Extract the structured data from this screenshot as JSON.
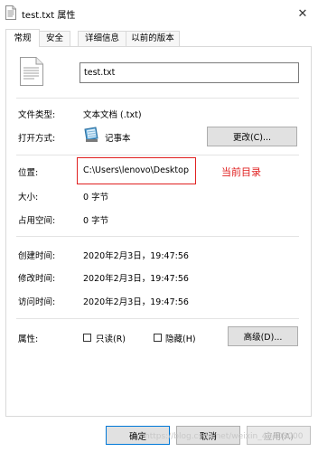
{
  "window": {
    "title": "test.txt 属性",
    "close_glyph": "✕"
  },
  "tabs": [
    {
      "label": "常规"
    },
    {
      "label": "安全"
    },
    {
      "label": "详细信息"
    },
    {
      "label": "以前的版本"
    }
  ],
  "general": {
    "file_name": "test.txt",
    "file_type_label": "文件类型:",
    "file_type_value": "文本文档 (.txt)",
    "open_with_label": "打开方式:",
    "open_with_value": "记事本",
    "change_button": "更改(C)...",
    "location_label": "位置:",
    "location_value": "C:\\Users\\lenovo\\Desktop",
    "location_annotation": "当前目录",
    "size_label": "大小:",
    "size_value": "0 字节",
    "size_on_disk_label": "占用空间:",
    "size_on_disk_value": "0 字节",
    "created_label": "创建时间:",
    "created_value": "2020年2月3日，19:47:56",
    "modified_label": "修改时间:",
    "modified_value": "2020年2月3日，19:47:56",
    "accessed_label": "访问时间:",
    "accessed_value": "2020年2月3日，19:47:56",
    "attributes_label": "属性:",
    "readonly_label": "只读(R)",
    "readonly_checked": false,
    "hidden_label": "隐藏(H)",
    "hidden_checked": false,
    "advanced_button": "高级(D)..."
  },
  "footer": {
    "ok_button": "确定",
    "cancel_button": "取消",
    "apply_button": "应用(A)"
  },
  "watermark": "https://blog.csdn.net/weixin_43408000",
  "colors": {
    "annotation": "#e02020",
    "primary_border": "#0078d7"
  }
}
